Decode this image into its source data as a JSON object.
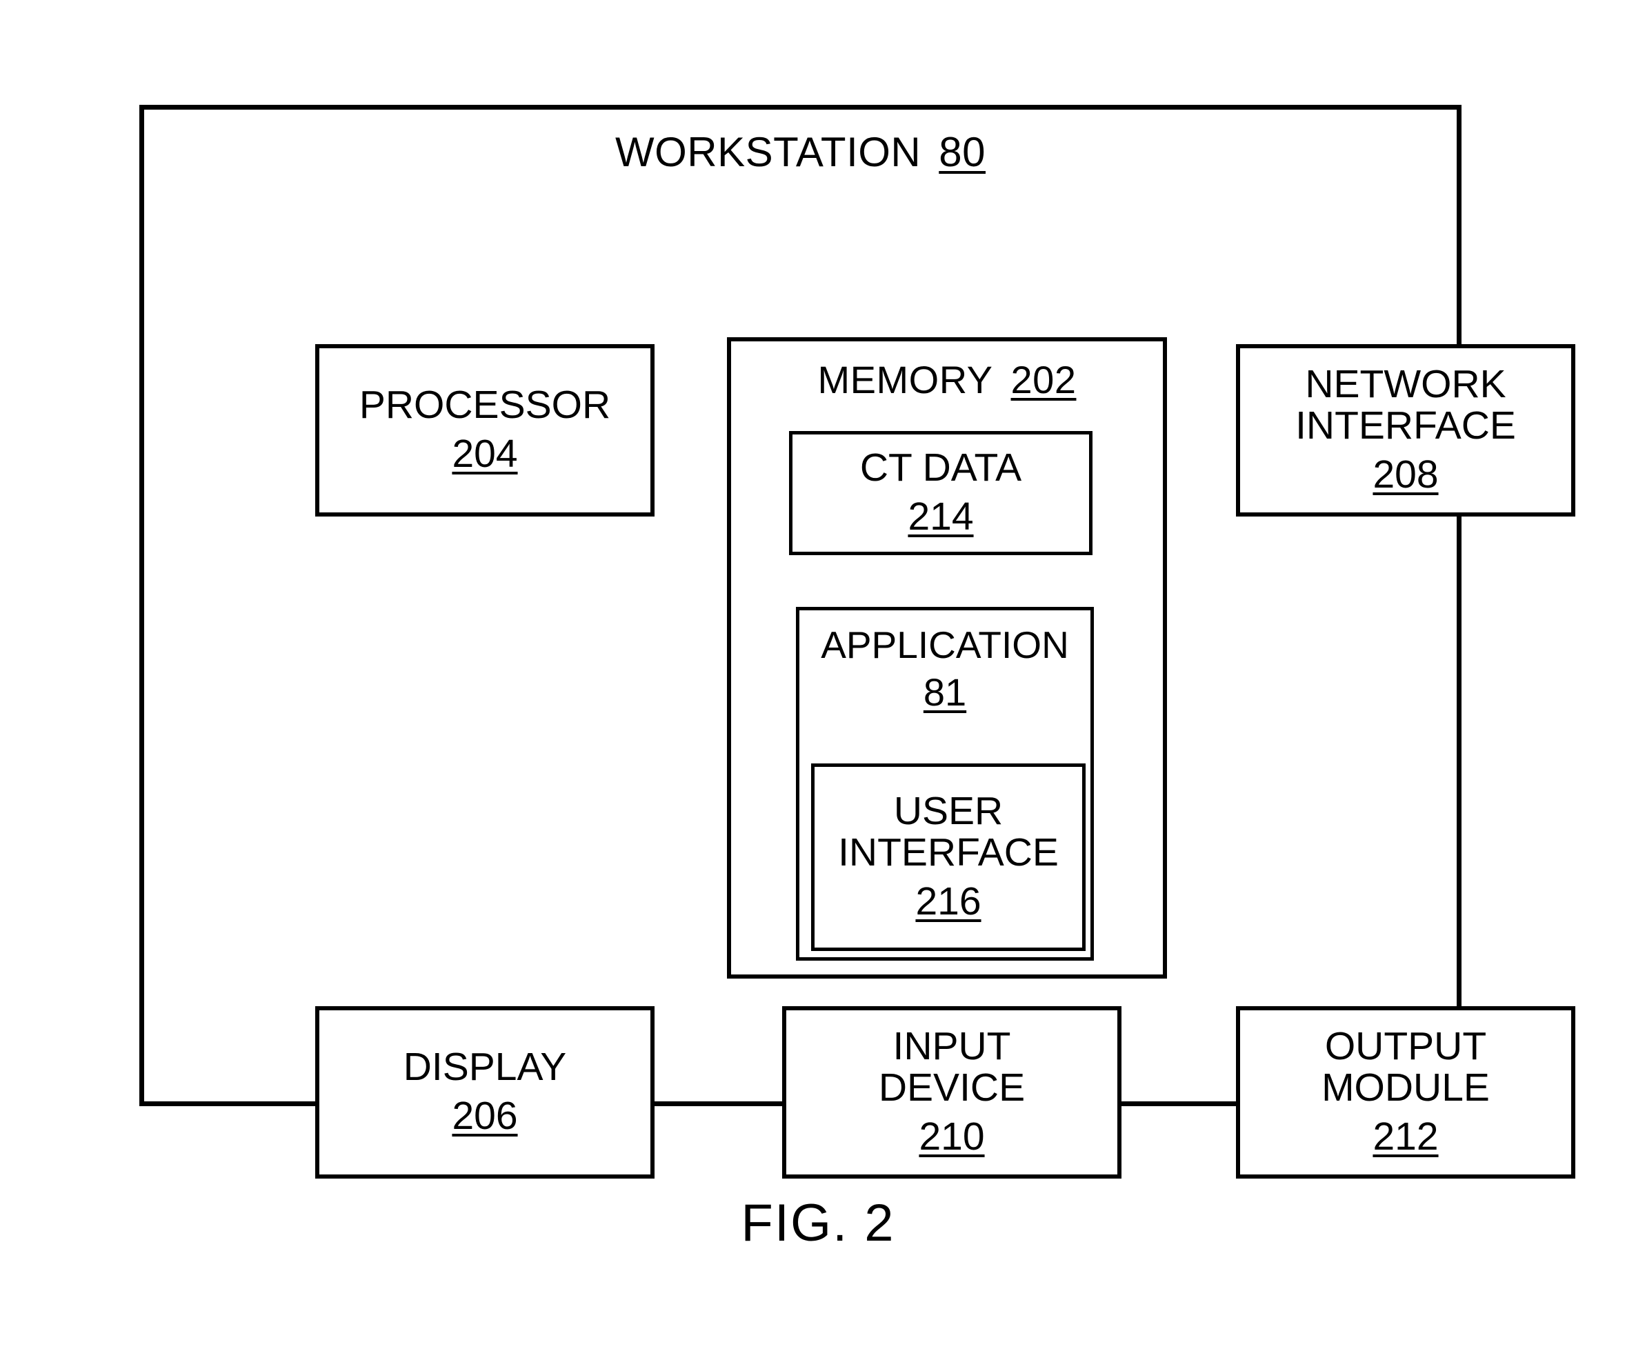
{
  "figure": {
    "caption": "FIG. 2"
  },
  "workstation": {
    "title_label": "WORKSTATION",
    "ref": "80"
  },
  "memory": {
    "title_label": "MEMORY",
    "ref": "202"
  },
  "components": {
    "processor": {
      "lines": [
        "PROCESSOR"
      ],
      "ref": "204"
    },
    "network_interface": {
      "lines": [
        "NETWORK",
        "INTERFACE"
      ],
      "line1": "NETWORK",
      "line2": "INTERFACE",
      "ref": "208"
    },
    "ct_data": {
      "lines": [
        "CT DATA"
      ],
      "line1": "CT DATA",
      "ref": "214"
    },
    "application": {
      "line1": "APPLICATION",
      "ref": "81"
    },
    "user_interface": {
      "line1": "USER",
      "line2": "INTERFACE",
      "ref": "216"
    },
    "display": {
      "line1": "DISPLAY",
      "ref": "206"
    },
    "input_device": {
      "line1": "INPUT",
      "line2": "DEVICE",
      "ref": "210"
    },
    "output_module": {
      "line1": "OUTPUT",
      "line2": "MODULE",
      "ref": "212"
    }
  },
  "colors": {
    "stroke": "#000000",
    "background": "#ffffff"
  }
}
